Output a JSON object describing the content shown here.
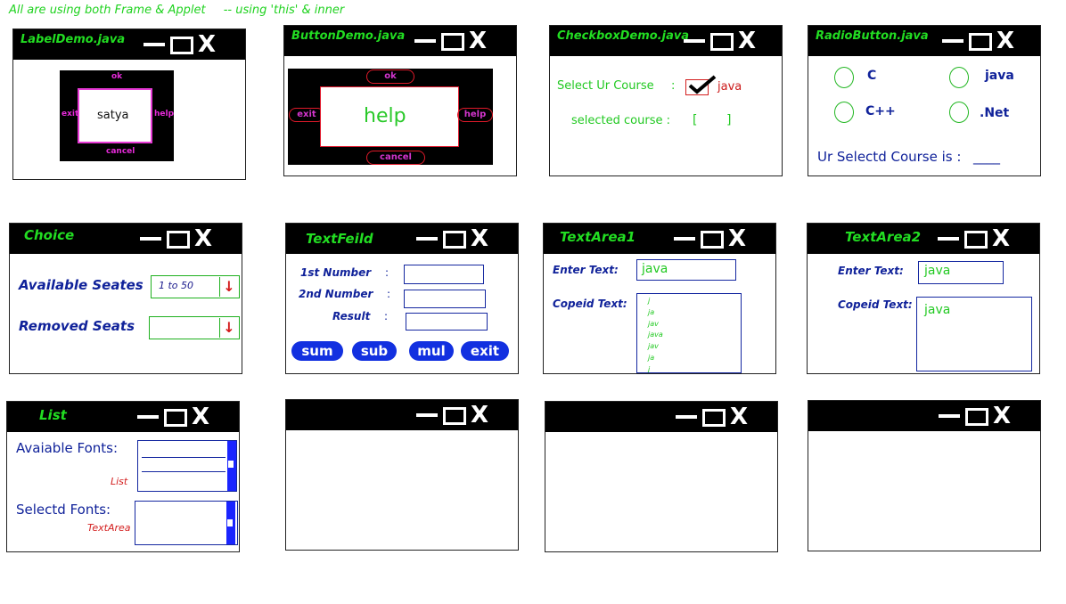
{
  "heading": {
    "main": "All are using both Frame & Applet",
    "sub": "--  using 'this' & inner"
  },
  "controls": {
    "close_glyph": "X"
  },
  "windows": {
    "label_demo": {
      "title": "LabelDemo.java",
      "north": "ok",
      "west": "exit",
      "center": "satya",
      "east": "help",
      "south": "cancel"
    },
    "button_demo": {
      "title": "ButtonDemo.java",
      "north": "ok",
      "west": "exit",
      "center": "help",
      "east": "help",
      "south": "cancel"
    },
    "checkbox_demo": {
      "title": "CheckboxDemo.java",
      "select_label": "Select Ur Course",
      "colon": ":",
      "check_label": "java",
      "selected_label": "selected course :",
      "bracket_open": "[",
      "bracket_close": "]"
    },
    "radio_demo": {
      "title": "RadioButton.java",
      "options": [
        "C",
        "java",
        "C++",
        ".Net"
      ],
      "result_label": "Ur Selectd Course is :",
      "result_value": "____"
    },
    "choice": {
      "title": "Choice",
      "available_label": "Available Seates",
      "available_value": "1 to 50",
      "removed_label": "Removed Seats",
      "arrow": "↓"
    },
    "textfield": {
      "title": "TextFeild",
      "first": "1st Number",
      "second": "2nd Number",
      "result": "Result",
      "colon": ":",
      "buttons": [
        "sum",
        "sub",
        "mul",
        "exit"
      ]
    },
    "textarea1": {
      "title": "TextArea1",
      "enter_label": "Enter Text:",
      "enter_value": "java",
      "copied_label": "Copeid Text:",
      "copied_lines": [
        "j",
        "ja",
        "jav",
        "java",
        "jav",
        "ja",
        "j"
      ]
    },
    "textarea2": {
      "title": "TextArea2",
      "enter_label": "Enter Text:",
      "enter_value": "java",
      "copied_label": "Copeid Text:",
      "copied_value": "java"
    },
    "list": {
      "title": "List",
      "fonts_label": "Avaiable Fonts:",
      "list_caption": "List",
      "selected_label": "Selectd Fonts:",
      "textarea_caption": "TextArea"
    }
  }
}
